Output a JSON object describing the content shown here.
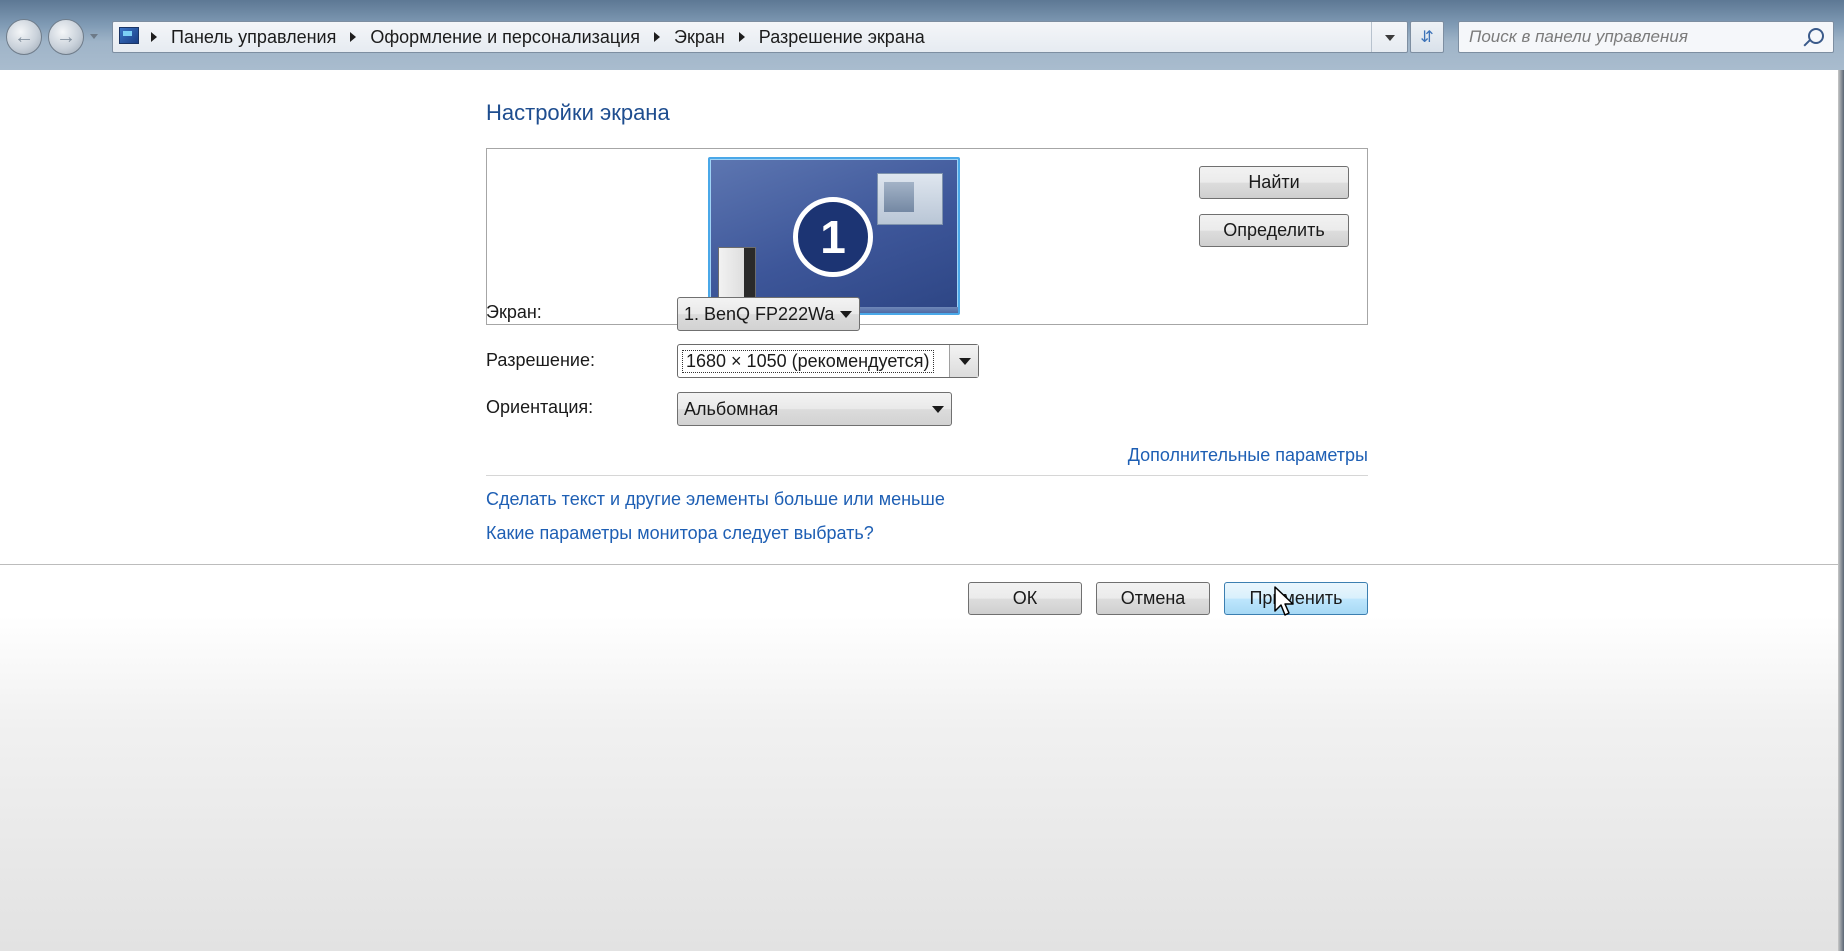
{
  "search": {
    "placeholder": "Поиск в панели управления"
  },
  "breadcrumb": [
    "Панель управления",
    "Оформление и персонализация",
    "Экран",
    "Разрешение экрана"
  ],
  "page": {
    "title": "Настройки экрана"
  },
  "preview": {
    "monitor_number": "1",
    "find_button": "Найти",
    "identify_button": "Определить"
  },
  "fields": {
    "display_label": "Экран:",
    "display_value": "1. BenQ FP222Wa",
    "resolution_label": "Разрешение:",
    "resolution_value": "1680 × 1050 (рекомендуется)",
    "orientation_label": "Ориентация:",
    "orientation_value": "Альбомная"
  },
  "links": {
    "advanced": "Дополнительные параметры",
    "text_size": "Сделать текст и другие элементы больше или меньше",
    "monitor_help": "Какие параметры монитора следует выбрать?"
  },
  "buttons": {
    "ok": "ОК",
    "cancel": "Отмена",
    "apply": "Применить"
  },
  "colors": {
    "link": "#1e5fb4",
    "title": "#1e4d8f",
    "monitor": "#3d5699"
  }
}
